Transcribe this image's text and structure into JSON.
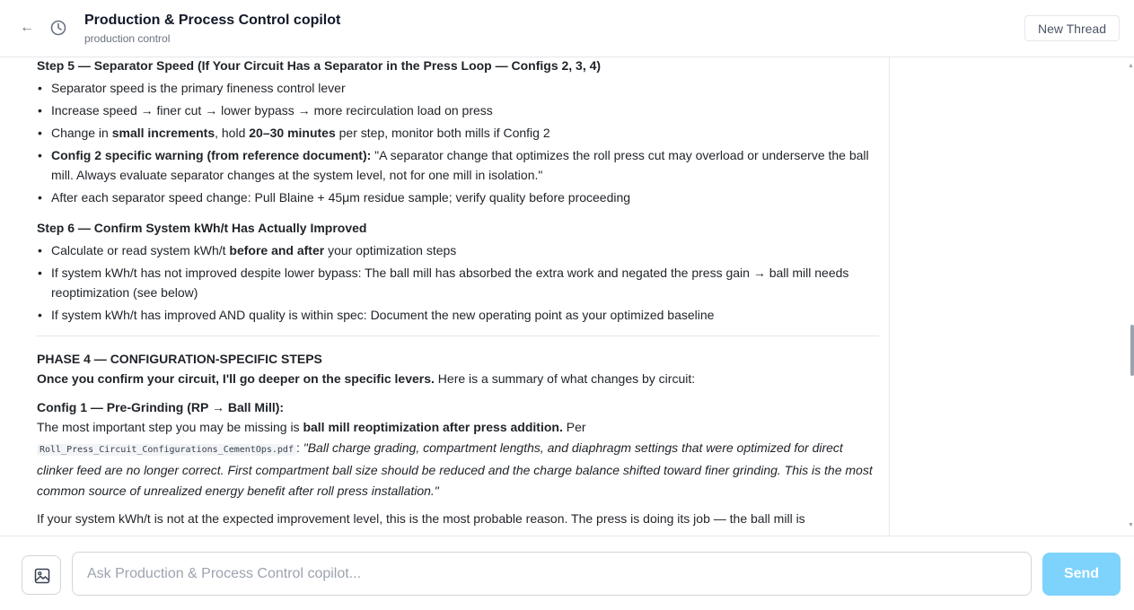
{
  "header": {
    "back_glyph": "←",
    "title": "Production & Process Control copilot",
    "subtitle": "production control",
    "new_thread_label": "New Thread"
  },
  "message": {
    "step5": {
      "heading": "Step 5 — Separator Speed (If Your Circuit Has a Separator in the Press Loop — Configs 2, 3, 4)",
      "b1": "Separator speed is the primary fineness control lever",
      "b2": "Increase speed → finer cut → lower bypass → more recirculation load on press",
      "b3_pre": "Change in ",
      "b3_bold1": "small increments",
      "b3_mid": ", hold ",
      "b3_bold2": "20–30 minutes",
      "b3_post": " per step, monitor both mills if Config 2",
      "b4_bold": "Config 2 specific warning (from reference document):",
      "b4_text": " \"A separator change that optimizes the roll press cut may overload or underserve the ball mill. Always evaluate separator changes at the system level, not for one mill in isolation.\"",
      "b5": "After each separator speed change: Pull Blaine + 45μm residue sample; verify quality before proceeding"
    },
    "step6": {
      "heading": "Step 6 — Confirm System kWh/t Has Actually Improved",
      "b1_pre": "Calculate or read system kWh/t ",
      "b1_bold": "before and after",
      "b1_post": " your optimization steps",
      "b2": "If system kWh/t has not improved despite lower bypass: The ball mill has absorbed the extra work and negated the press gain → ball mill needs reoptimization (see below)",
      "b3": "If system kWh/t has improved AND quality is within spec: Document the new operating point as your optimized baseline"
    },
    "phase4": {
      "heading": "PHASE 4 — CONFIGURATION-SPECIFIC STEPS",
      "intro_bold": "Once you confirm your circuit, I'll go deeper on the specific levers.",
      "intro_text": " Here is a summary of what changes by circuit:",
      "config1_heading": "Config 1 — Pre-Grinding (RP → Ball Mill):",
      "config1_pre": "The most important step you may be missing is ",
      "config1_bold": "ball mill reoptimization after press addition.",
      "config1_per": " Per",
      "config1_file": "Roll_Press_Circuit_Configurations_CementOps.pdf",
      "config1_colon": ": ",
      "config1_quote": "\"Ball charge grading, compartment lengths, and diaphragm settings that were optimized for direct clinker feed are no longer correct. First compartment ball size should be reduced and the charge balance shifted toward finer grinding. This is the most common source of unrealized energy benefit after roll press installation.\"",
      "last_line": "If your system kWh/t is not at the expected improvement level, this is the most probable reason. The press is doing its job — the ball mill is"
    }
  },
  "composer": {
    "placeholder": "Ask Production & Process Control copilot...",
    "send_label": "Send"
  },
  "scrollbar": {
    "up_glyph": "▲",
    "down_glyph": "▼"
  }
}
